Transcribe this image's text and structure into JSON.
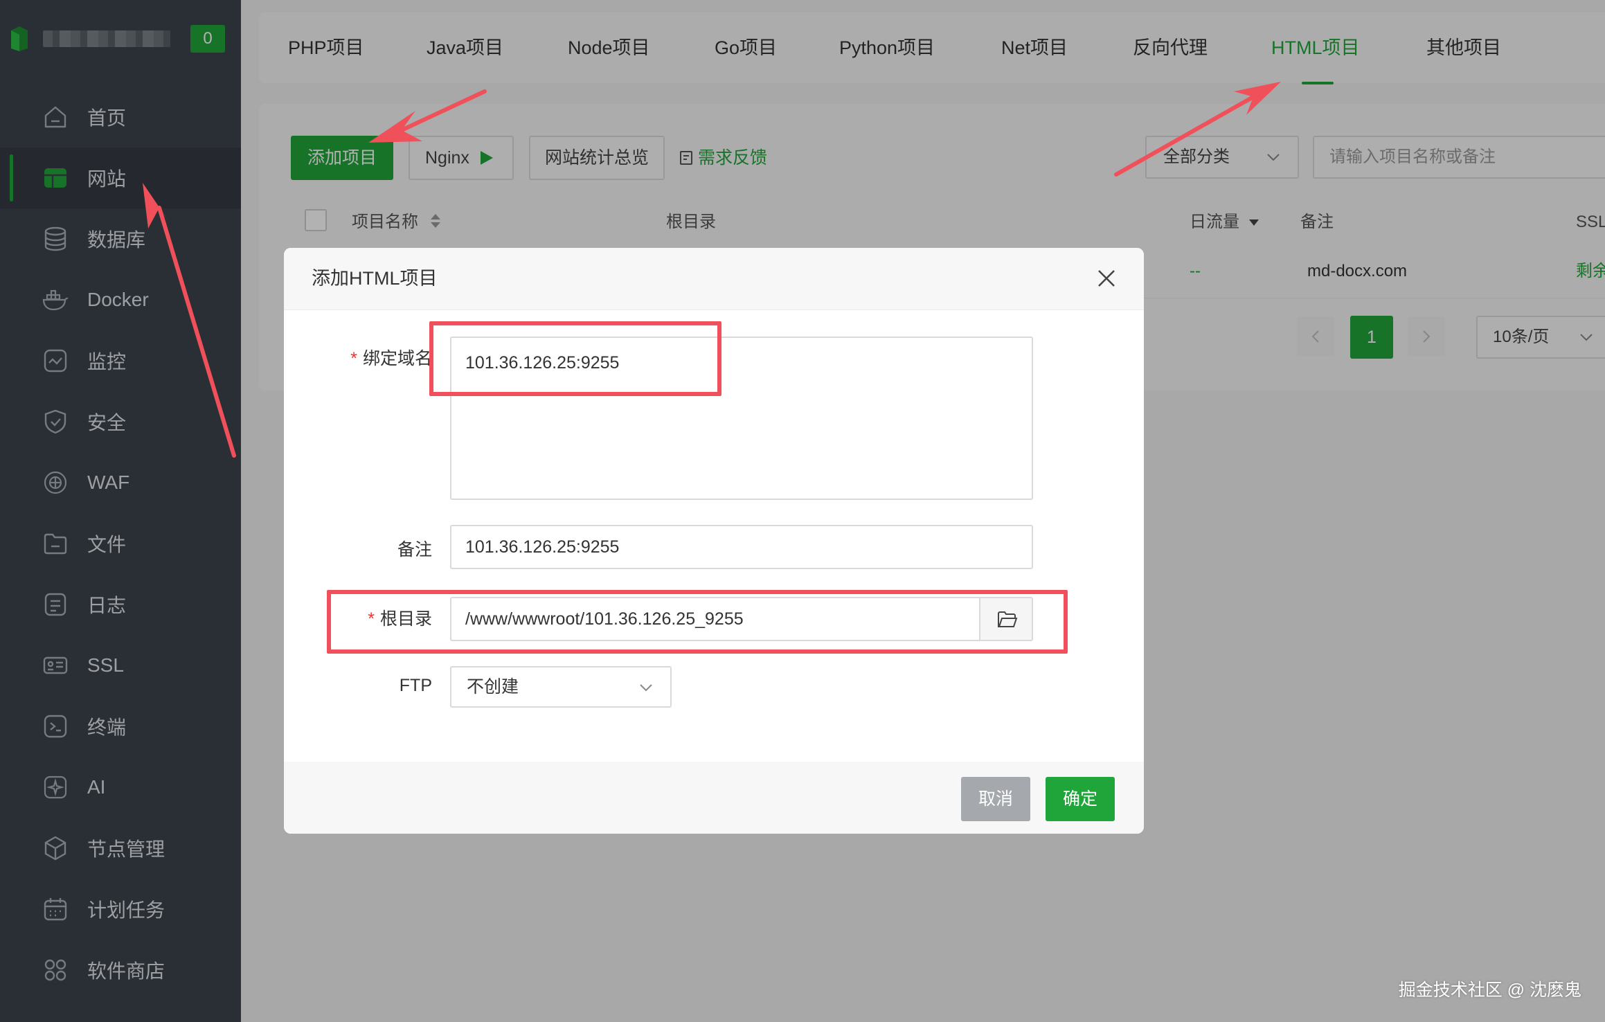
{
  "sidebar": {
    "badge": "0",
    "items": [
      {
        "label": "首页"
      },
      {
        "label": "网站"
      },
      {
        "label": "数据库"
      },
      {
        "label": "Docker"
      },
      {
        "label": "监控"
      },
      {
        "label": "安全"
      },
      {
        "label": "WAF"
      },
      {
        "label": "文件"
      },
      {
        "label": "日志"
      },
      {
        "label": "SSL"
      },
      {
        "label": "终端"
      },
      {
        "label": "AI"
      },
      {
        "label": "节点管理"
      },
      {
        "label": "计划任务"
      },
      {
        "label": "软件商店"
      }
    ]
  },
  "tabs": [
    "PHP项目",
    "Java项目",
    "Node项目",
    "Go项目",
    "Python项目",
    "Net项目",
    "反向代理",
    "HTML项目",
    "其他项目"
  ],
  "toolbar": {
    "add_label": "添加项目",
    "nginx_label": "Nginx",
    "stats_label": "网站统计总览",
    "feedback_label": "需求反馈",
    "category_label": "全部分类",
    "search_placeholder": "请输入项目名称或备注"
  },
  "table": {
    "headers": {
      "name": "项目名称",
      "root": "根目录",
      "traffic": "日流量",
      "note": "备注",
      "ssl": "SSL"
    },
    "row": {
      "traffic": "--",
      "note": "md-docx.com",
      "ssl": "剩余"
    }
  },
  "pagination": {
    "page": "1",
    "page_size": "10条/页"
  },
  "modal": {
    "title": "添加HTML项目",
    "domain_label": "绑定域名",
    "domain_value": "101.36.126.25:9255",
    "note_label": "备注",
    "note_value": "101.36.126.25:9255",
    "root_label": "根目录",
    "root_value": "/www/wwwroot/101.36.126.25_9255",
    "ftp_label": "FTP",
    "ftp_value": "不创建",
    "cancel_label": "取消",
    "ok_label": "确定"
  },
  "watermark": "掘金技术社区 @ 沈麽鬼",
  "colors": {
    "accent": "#20a53a",
    "sidebar_bg": "#3c444d",
    "annotation": "#f0505a"
  }
}
